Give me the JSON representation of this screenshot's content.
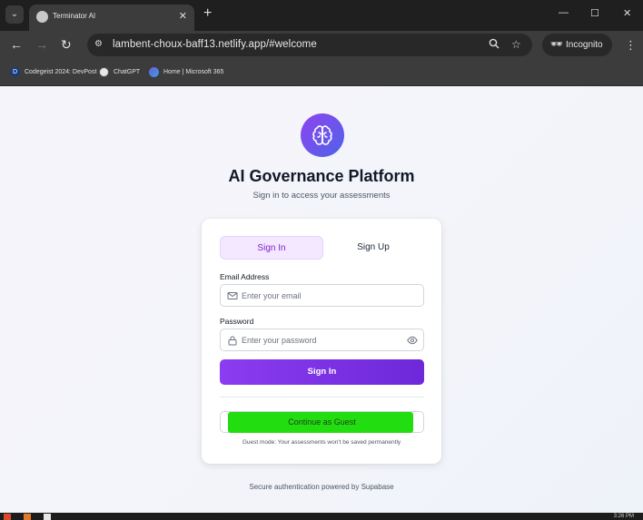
{
  "browser": {
    "tab_title": "Terminator AI",
    "url": "lambent-choux-baff13.netlify.app/#welcome",
    "incognito_label": "Incognito",
    "bookmarks": [
      {
        "label": "Codegeist 2024: DevPost",
        "icon_letter": "D",
        "color": "#1a3a7a"
      },
      {
        "label": "ChatGPT",
        "icon_letter": "",
        "color": "#e8e8e8"
      },
      {
        "label": "Home | Microsoft 365",
        "icon_letter": "",
        "color": "#6b5bd6"
      }
    ]
  },
  "page": {
    "title": "AI Governance Platform",
    "subtitle": "Sign in to access your assessments",
    "footer": "Secure authentication powered by Supabase"
  },
  "auth_card": {
    "tabs": {
      "signin": "Sign In",
      "signup": "Sign Up"
    },
    "email": {
      "label": "Email Address",
      "placeholder": "Enter your email"
    },
    "password": {
      "label": "Password",
      "placeholder": "Enter your password"
    },
    "submit_label": "Sign In",
    "guest_label": "Continue as Guest",
    "guest_note": "Guest mode: Your assessments won't be saved permanently",
    "accent_color": "#7e22ce",
    "guest_highlight_color": "#22dd0f"
  },
  "taskbar": {
    "clock": "3:26 PM"
  }
}
